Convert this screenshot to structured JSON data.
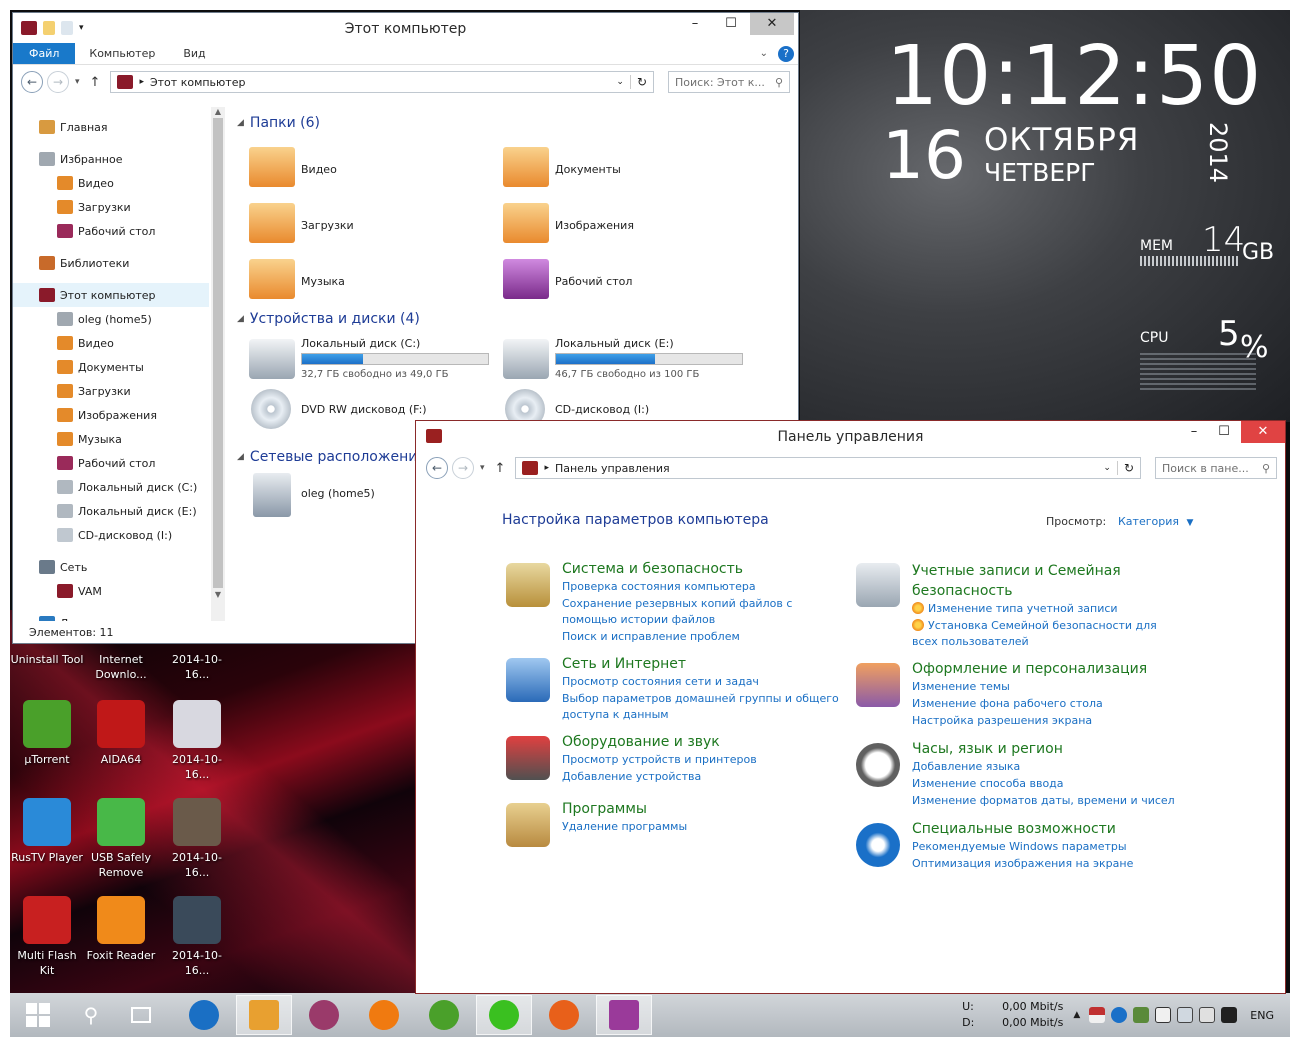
{
  "explorer": {
    "title": "Этот компьютер",
    "ribbon_tabs": [
      "Файл",
      "Компьютер",
      "Вид"
    ],
    "address": "Этот компьютер",
    "search_placeholder": "Поиск: Этот к...",
    "nav": [
      {
        "label": "Главная",
        "icon": "home-icon"
      },
      {
        "label": "Избранное",
        "icon": "star-icon"
      },
      {
        "label": "Видео",
        "icon": "video-folder-icon"
      },
      {
        "label": "Загрузки",
        "icon": "downloads-folder-icon"
      },
      {
        "label": "Рабочий стол",
        "icon": "desktop-folder-icon"
      },
      {
        "label": "Библиотеки",
        "icon": "libraries-icon"
      },
      {
        "label": "Этот компьютер",
        "icon": "computer-icon"
      },
      {
        "label": "oleg (home5)",
        "icon": "network-drive-icon"
      },
      {
        "label": "Видео",
        "icon": "video-folder-icon"
      },
      {
        "label": "Документы",
        "icon": "documents-folder-icon"
      },
      {
        "label": "Загрузки",
        "icon": "downloads-folder-icon"
      },
      {
        "label": "Изображения",
        "icon": "pictures-folder-icon"
      },
      {
        "label": "Музыка",
        "icon": "music-folder-icon"
      },
      {
        "label": "Рабочий стол",
        "icon": "desktop-folder-icon"
      },
      {
        "label": "Локальный диск (C:)",
        "icon": "drive-icon"
      },
      {
        "label": "Локальный диск (E:)",
        "icon": "drive-icon"
      },
      {
        "label": "CD-дисковод (I:)",
        "icon": "cd-drive-icon"
      },
      {
        "label": "Сеть",
        "icon": "network-icon"
      },
      {
        "label": "VAM",
        "icon": "computer-icon"
      },
      {
        "label": "Домашняя группа",
        "icon": "homegroup-icon"
      }
    ],
    "folders_header": "Папки (6)",
    "folders": [
      "Видео",
      "Документы",
      "Загрузки",
      "Изображения",
      "Музыка",
      "Рабочий стол"
    ],
    "devices_header": "Устройства и диски (4)",
    "drives": [
      {
        "label": "Локальный диск (C:)",
        "free": "32,7 ГБ свободно из 49,0 ГБ",
        "fill": 0.33
      },
      {
        "label": "Локальный диск (E:)",
        "free": "46,7 ГБ свободно из 100 ГБ",
        "fill": 0.53
      }
    ],
    "optical": [
      "DVD RW дисковод (F:)",
      "CD-дисковод (I:)"
    ],
    "network_header": "Сетевые расположения",
    "network_item": "oleg (home5)",
    "status": "Элементов: 11"
  },
  "control_panel": {
    "title": "Панель управления",
    "address": "Панель управления",
    "search_placeholder": "Поиск в пане...",
    "heading": "Настройка параметров компьютера",
    "view_label": "Просмотр:",
    "view_value": "Категория",
    "categories": [
      {
        "title": "Система и безопасность",
        "icon": "lock-icon",
        "links": [
          "Проверка состояния компьютера",
          "Сохранение резервных копий файлов с помощью истории файлов",
          "Поиск и исправление проблем"
        ]
      },
      {
        "title": "Сеть и Интернет",
        "icon": "network-globe-icon",
        "links": [
          "Просмотр состояния сети и задач",
          "Выбор параметров домашней группы и общего доступа к данным"
        ]
      },
      {
        "title": "Оборудование и звук",
        "icon": "microphone-icon",
        "links": [
          "Просмотр устройств и принтеров",
          "Добавление устройства"
        ]
      },
      {
        "title": "Программы",
        "icon": "programs-box-icon",
        "links": [
          "Удаление программы"
        ]
      },
      {
        "title": "Учетные записи и Семейная безопасность",
        "icon": "users-icon",
        "links": [
          "Изменение типа учетной записи",
          "Установка Семейной безопасности для всех пользователей"
        ]
      },
      {
        "title": "Оформление и персонализация",
        "icon": "appearance-icon",
        "links": [
          "Изменение темы",
          "Изменение фона рабочего стола",
          "Настройка разрешения экрана"
        ]
      },
      {
        "title": "Часы, язык и регион",
        "icon": "clock-icon",
        "links": [
          "Добавление языка",
          "Изменение способа ввода",
          "Изменение форматов даты, времени и чисел"
        ]
      },
      {
        "title": "Специальные возможности",
        "icon": "accessibility-icon",
        "links": [
          "Рекомендуемые Windows параметры",
          "Оптимизация изображения на экране"
        ]
      }
    ]
  },
  "clock_widget": {
    "time": "10:12:50",
    "day": "16",
    "month": "ОКТЯБРЯ",
    "weekday": "ЧЕТВЕРГ",
    "year": "2014",
    "mem_label": "MEM",
    "mem_value": "14",
    "mem_unit": "GB",
    "cpu_label": "CPU",
    "cpu_value": "5",
    "cpu_unit": "%"
  },
  "desktop_icons": [
    {
      "label": "Uninstall Tool",
      "color": "#6a6a6a"
    },
    {
      "label": "Internet Downlo...",
      "color": "#4a8a3a"
    },
    {
      "label": "2014-10-16...",
      "color": "#7a7a7a"
    },
    {
      "label": "µTorrent",
      "color": "#4aa02a"
    },
    {
      "label": "AIDA64",
      "color": "#c01818"
    },
    {
      "label": "2014-10-16...",
      "color": "#d8d8e0"
    },
    {
      "label": "RusTV Player",
      "color": "#2a8ad8"
    },
    {
      "label": "USB Safely Remove",
      "color": "#48b848"
    },
    {
      "label": "2014-10-16...",
      "color": "#6a5a4a"
    },
    {
      "label": "Multi Flash Kit",
      "color": "#c82020"
    },
    {
      "label": "Foxit Reader",
      "color": "#f08a1a"
    },
    {
      "label": "2014-10-16...",
      "color": "#3a4a5a"
    }
  ],
  "taskbar": {
    "apps": [
      {
        "name": "explorer",
        "icon": "ie-icon",
        "color": "#1a6fc4"
      },
      {
        "name": "file-explorer",
        "icon": "folder-icon",
        "color": "#e8a030"
      },
      {
        "name": "winrar",
        "icon": "books-icon",
        "color": "#9a3a6a"
      },
      {
        "name": "app-orange",
        "icon": "orange-app-icon",
        "color": "#f07a10"
      },
      {
        "name": "utorrent",
        "icon": "utorrent-icon",
        "color": "#4aa02a"
      },
      {
        "name": "icq",
        "icon": "icq-icon",
        "color": "#3ac020"
      },
      {
        "name": "firefox",
        "icon": "firefox-icon",
        "color": "#e8601a"
      },
      {
        "name": "control-panel",
        "icon": "control-panel-icon",
        "color": "#9a3a9a"
      }
    ],
    "net_u_label": "U:",
    "net_u_value": "0,00 Mbit/s",
    "net_d_label": "D:",
    "net_d_value": "0,00 Mbit/s",
    "lang": "ENG"
  }
}
